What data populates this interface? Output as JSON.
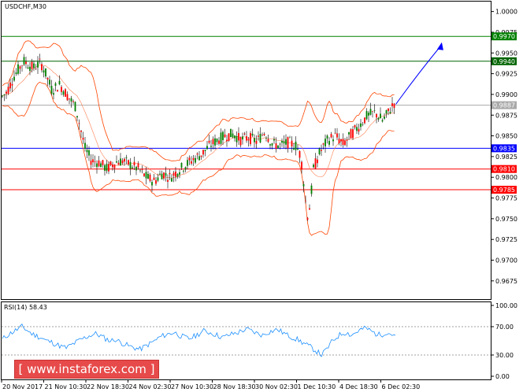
{
  "chart_data": [
    {
      "type": "candlestick",
      "title": "USDCHF,M30",
      "y_ticks": [
        "1.0000",
        "0.9975",
        "0.9950",
        "0.9925",
        "0.9900",
        "0.9875",
        "0.9850",
        "0.9825",
        "0.9800",
        "0.9775",
        "0.9750",
        "0.9725",
        "0.9700",
        "0.9675"
      ],
      "ylim": [
        0.9653,
        1.0012
      ],
      "x_ticks": [
        "20 Nov 2017",
        "21 Nov 10:30",
        "22 Nov 18:30",
        "24 Nov 02:30",
        "27 Nov 10:30",
        "28 Nov 18:30",
        "30 Nov 02:30",
        "1 Dec 10:30",
        "4 Dec 18:30",
        "6 Dec 02:30"
      ],
      "levels": [
        {
          "value": 0.997,
          "label": "0.9970",
          "color": "#008000",
          "label_bg": "#008000"
        },
        {
          "value": 0.994,
          "label": "0.9940",
          "color": "#006400",
          "label_bg": "#006400"
        },
        {
          "value": 0.9887,
          "label": "0.9887",
          "color": "#a9a9a9",
          "label_bg": "#a9a9a9"
        },
        {
          "value": 0.9835,
          "label": "0.9835",
          "color": "#0000ff",
          "label_bg": "#0000ff"
        },
        {
          "value": 0.981,
          "label": "0.9810",
          "color": "#ff0000",
          "label_bg": "#ff0000"
        },
        {
          "value": 0.9785,
          "label": "0.9785",
          "color": "#ff0000",
          "label_bg": "#ff0000"
        }
      ],
      "price_path": [
        [
          0,
          0.9895
        ],
        [
          8,
          0.9902
        ],
        [
          18,
          0.9922
        ],
        [
          30,
          0.994
        ],
        [
          42,
          0.9932
        ],
        [
          52,
          0.9938
        ],
        [
          58,
          0.9925
        ],
        [
          66,
          0.9905
        ],
        [
          76,
          0.9912
        ],
        [
          86,
          0.9898
        ],
        [
          96,
          0.9885
        ],
        [
          102,
          0.986
        ],
        [
          108,
          0.9835
        ],
        [
          116,
          0.982
        ],
        [
          126,
          0.9818
        ],
        [
          136,
          0.981
        ],
        [
          146,
          0.9818
        ],
        [
          156,
          0.982
        ],
        [
          166,
          0.9815
        ],
        [
          176,
          0.981
        ],
        [
          186,
          0.98
        ],
        [
          196,
          0.9795
        ],
        [
          206,
          0.9805
        ],
        [
          216,
          0.98
        ],
        [
          226,
          0.9808
        ],
        [
          236,
          0.9815
        ],
        [
          246,
          0.9822
        ],
        [
          256,
          0.9828
        ],
        [
          266,
          0.9838
        ],
        [
          276,
          0.9845
        ],
        [
          286,
          0.985
        ],
        [
          296,
          0.9852
        ],
        [
          306,
          0.9845
        ],
        [
          316,
          0.9848
        ],
        [
          326,
          0.9843
        ],
        [
          336,
          0.9855
        ],
        [
          346,
          0.984
        ],
        [
          356,
          0.9838
        ],
        [
          366,
          0.9842
        ],
        [
          376,
          0.9838
        ],
        [
          382,
          0.9825
        ],
        [
          386,
          0.979
        ],
        [
          390,
          0.9752
        ],
        [
          394,
          0.9768
        ],
        [
          398,
          0.981
        ],
        [
          406,
          0.983
        ],
        [
          416,
          0.9845
        ],
        [
          426,
          0.985
        ],
        [
          436,
          0.984
        ],
        [
          446,
          0.9852
        ],
        [
          456,
          0.9862
        ],
        [
          466,
          0.9874
        ],
        [
          476,
          0.9878
        ],
        [
          486,
          0.9868
        ],
        [
          494,
          0.988
        ],
        [
          502,
          0.9892
        ]
      ],
      "arrow_target": {
        "x_frac": 0.9,
        "value": 0.996
      },
      "arrow_color": "#0000ff"
    },
    {
      "type": "line",
      "title": "RSI(14) 58.43",
      "y_ticks": [
        "100.00",
        "70.00",
        "30.00",
        "0.00"
      ],
      "ylim": [
        0,
        100
      ],
      "levels": [
        70,
        30
      ],
      "series": [
        {
          "name": "RSI(14)",
          "color": "#1e90ff",
          "values": [
            52,
            58,
            62,
            66,
            70,
            65,
            60,
            57,
            54,
            50,
            48,
            45,
            42,
            40,
            44,
            48,
            52,
            55,
            58,
            60,
            57,
            53,
            50,
            52,
            48,
            45,
            42,
            40,
            38,
            42,
            46,
            50,
            55,
            58,
            60,
            62,
            58,
            55,
            53,
            56,
            60,
            64,
            62,
            60,
            57,
            55,
            58,
            60,
            62,
            65,
            66,
            63,
            60,
            58,
            62,
            64,
            66,
            62,
            58,
            55,
            52,
            48,
            44,
            40,
            35,
            30,
            38,
            48,
            55,
            60,
            62,
            58,
            62,
            66,
            68,
            64,
            60,
            58,
            62,
            60,
            58
          ]
        }
      ]
    }
  ],
  "watermark": "[ www.instaforex.com ]"
}
